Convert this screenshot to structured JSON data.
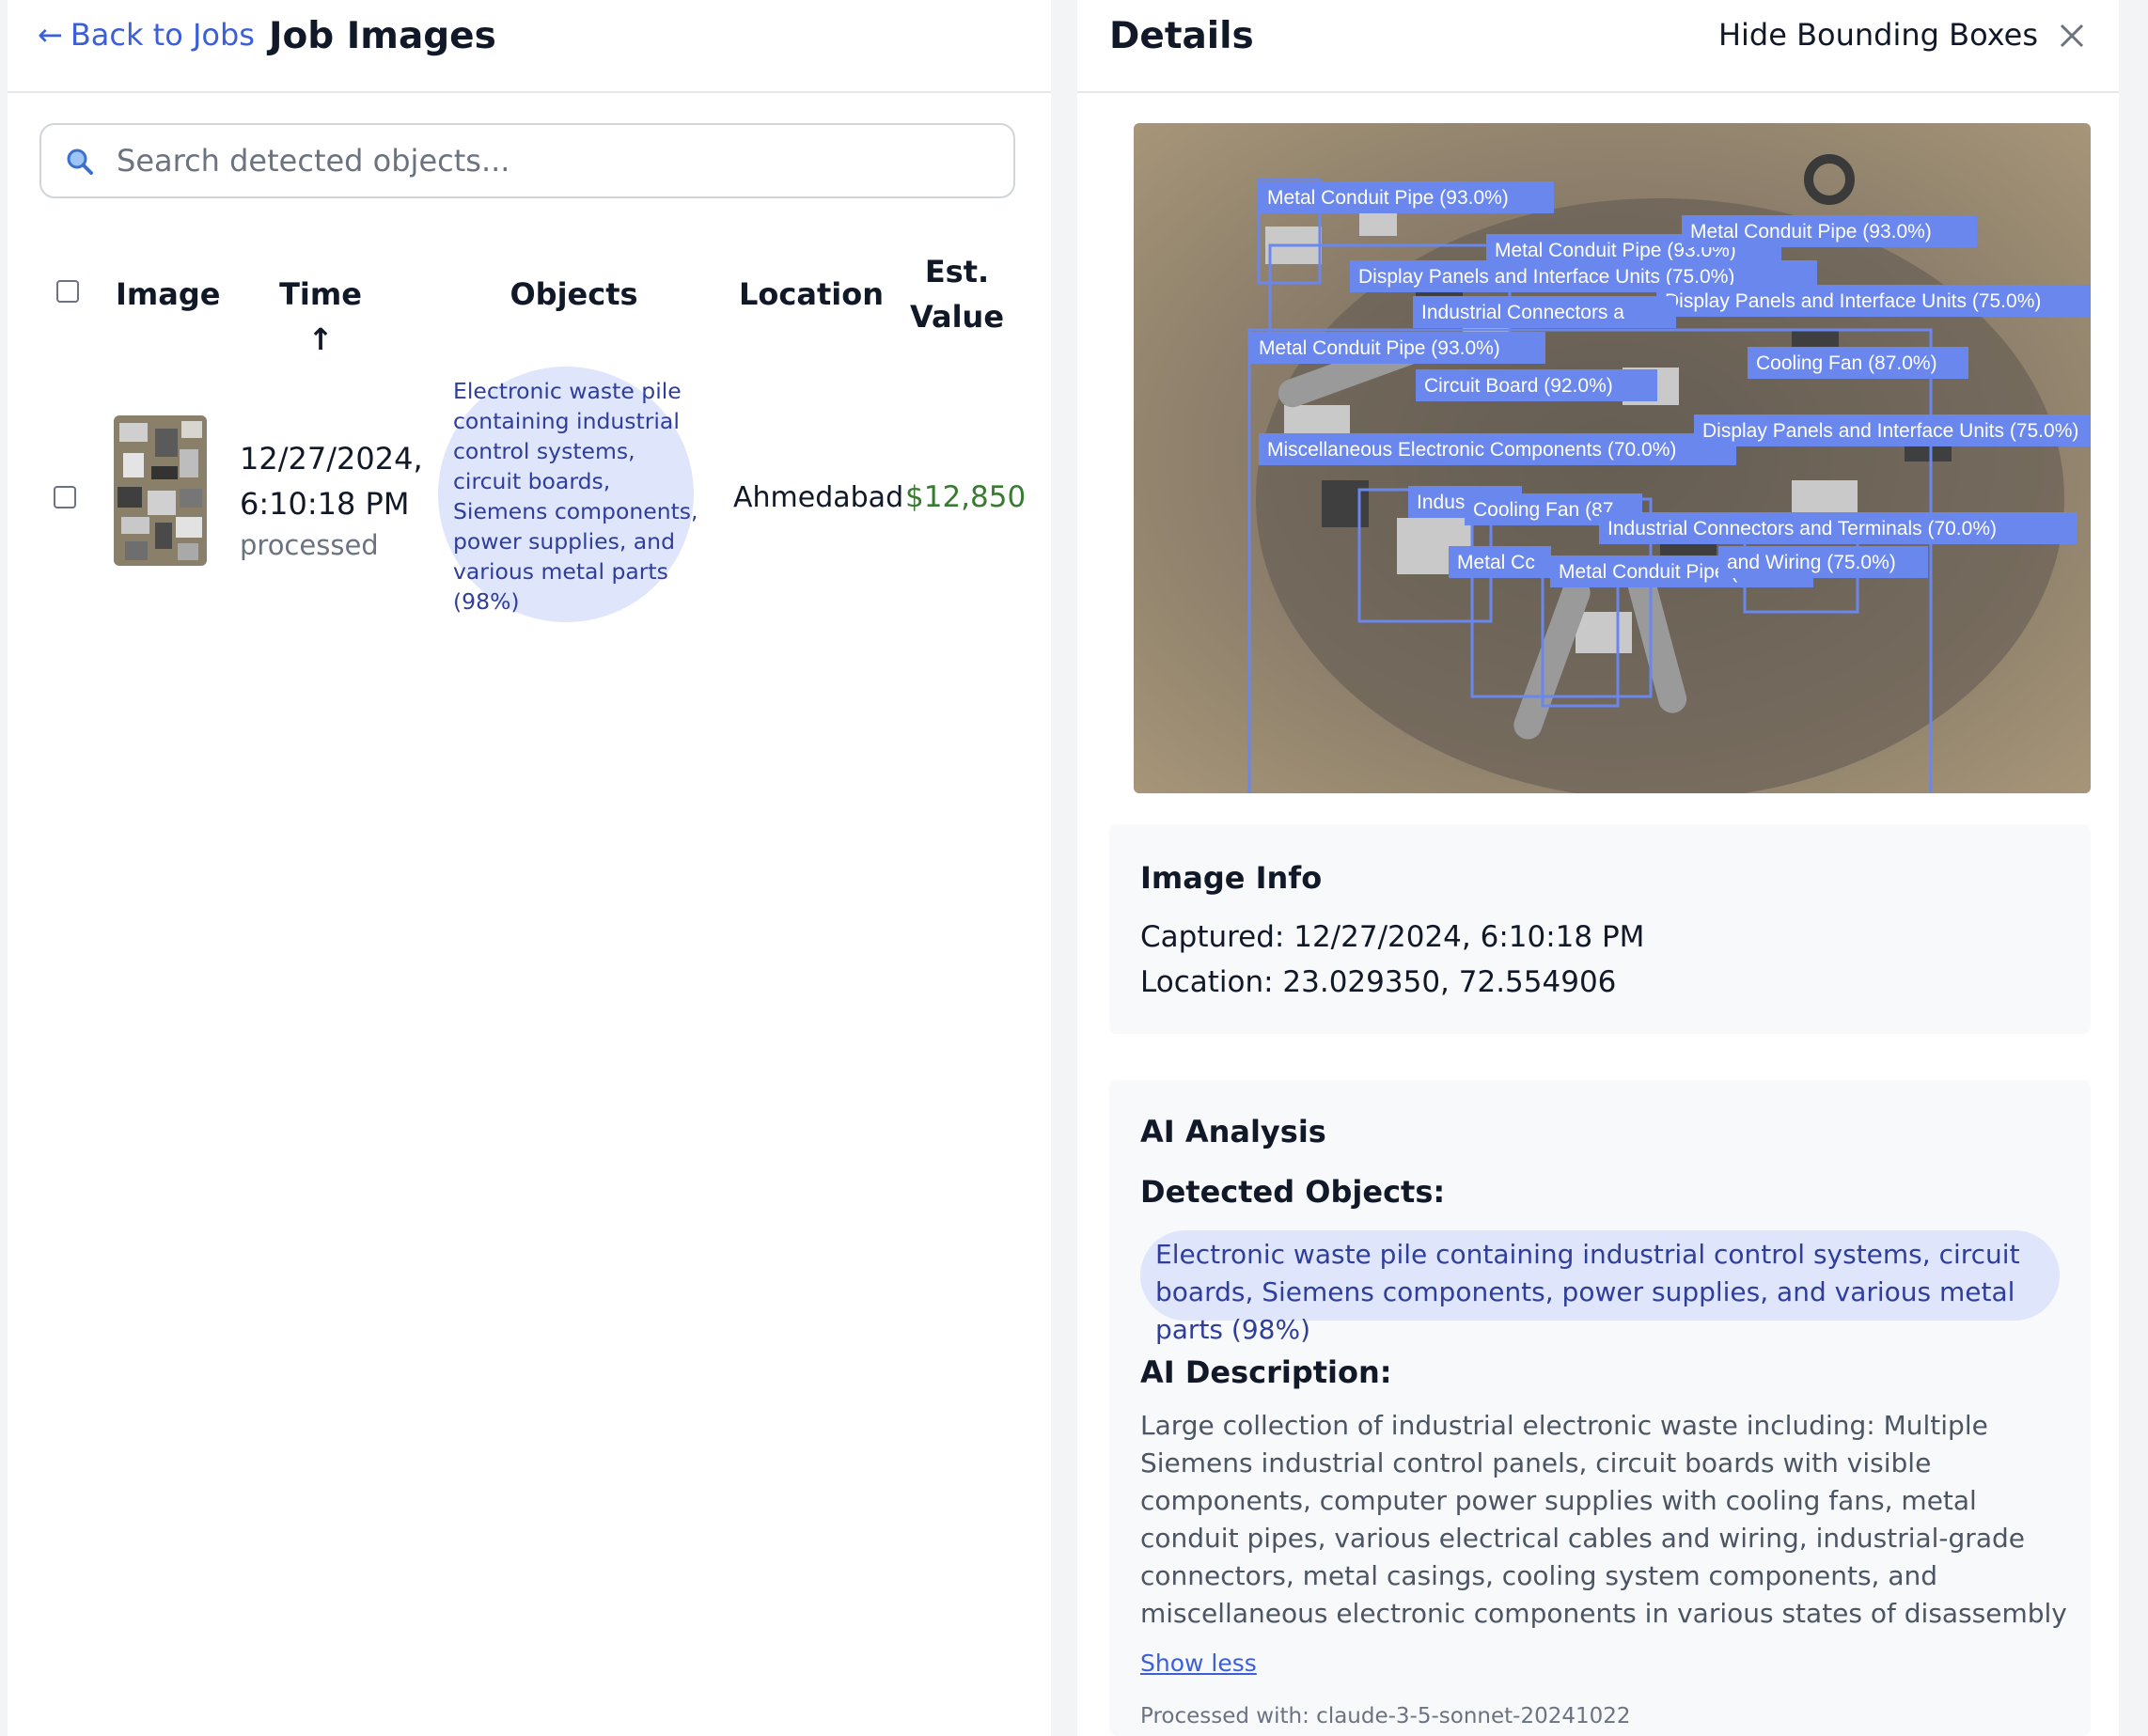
{
  "left_header": {
    "back_label": "Back to Jobs",
    "back_arrow": "←",
    "title": "Job Images"
  },
  "search": {
    "placeholder": "Search detected objects..."
  },
  "table": {
    "headers": {
      "image": "Image",
      "time": "Time ↑",
      "objects": "Objects",
      "location": "Location",
      "value_line1": "Est.",
      "value_line2": "Value"
    },
    "rows": [
      {
        "time_line1": "12/27/2024,",
        "time_line2": "6:10:18 PM",
        "status": "processed",
        "objects": "Electronic waste pile containing industrial control systems, circuit boards, Siemens components, power supplies, and various metal parts (98%)",
        "location": "Ahmedabad",
        "value": "$12,850"
      }
    ]
  },
  "details": {
    "title": "Details",
    "hide_boxes_label": "Hide Bounding Boxes",
    "boxes": [
      "Metal Conduit Pipe (93.0%)",
      "Metal Conduit Pipe (93.0%)",
      "Metal Conduit Pipe (93.0%)",
      "Display Panels and Interface Units (75.0%)",
      "Display Panels and Interface Units (75.0%)",
      "Industrial Connectors a",
      "Metal Conduit Pipe (93.0%)",
      "Circuit Board (92.0%)",
      "Cooling Fan (87.0%)",
      "Miscellaneous Electronic Components (70.0%)",
      "Display Panels and Interface Units (75.0%)",
      "Industria",
      "Cooling Fan (87",
      "Industrial Connectors and Terminals (70.0%)",
      "Metal Cc",
      "Metal Conduit Pipe (93.",
      "and Wiring (75.0%)"
    ],
    "image_info": {
      "heading": "Image Info",
      "captured": "Captured: 12/27/2024, 6:10:18 PM",
      "location": "Location: 23.029350, 72.554906"
    },
    "ai": {
      "heading": "AI Analysis",
      "detected_heading": "Detected Objects:",
      "detected": "Electronic waste pile containing industrial control systems, circuit boards, Siemens components, power supplies, and various metal parts (98%)",
      "desc_heading": "AI Description:",
      "description": "Large collection of industrial electronic waste including: Multiple Siemens industrial control panels, circuit boards with visible components, computer power supplies with cooling fans, metal conduit pipes, various electrical cables and wiring, industrial-grade connectors, metal casings, cooling system components, and miscellaneous electronic components in various states of disassembly",
      "show_less": "Show less",
      "processed_with": "Processed with: claude-3-5-sonnet-20241022"
    }
  },
  "colors": {
    "accent": "#3b5fd9",
    "box": "#6a87ee",
    "value": "#3a7a33",
    "bubble": "#dfe6fb"
  },
  "icons": [
    "search-icon",
    "close-icon"
  ]
}
